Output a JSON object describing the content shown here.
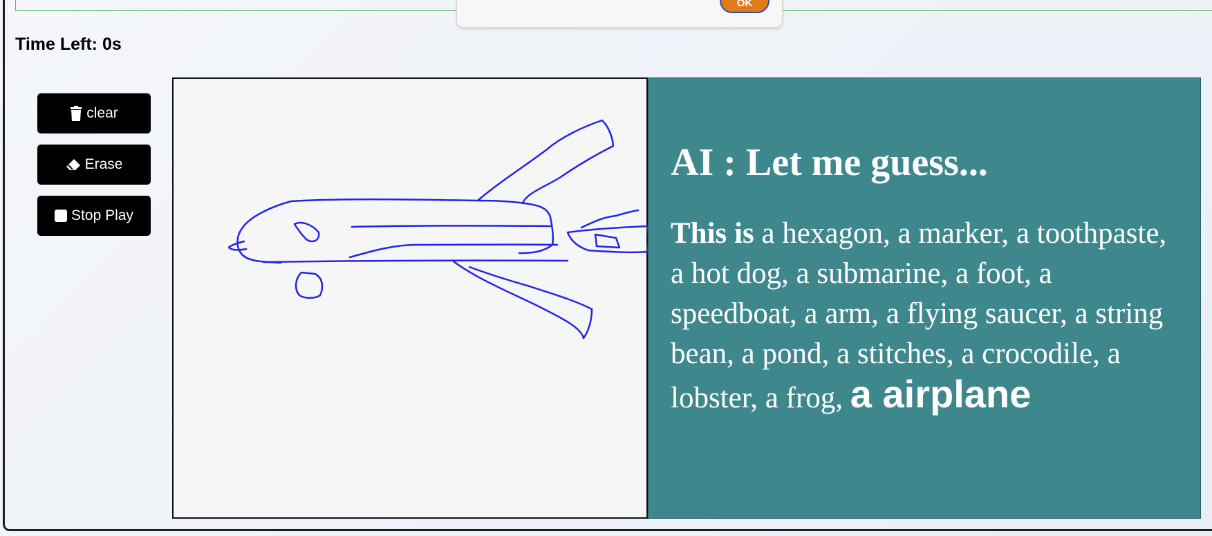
{
  "popup": {
    "ok_label": "OK"
  },
  "timer": {
    "text": "Time Left: 0s"
  },
  "toolbar": {
    "clear_label": "clear",
    "erase_label": "Erase",
    "stop_label": "Stop Play"
  },
  "icons": {
    "clear": "trash-icon",
    "erase": "eraser-icon",
    "stop": "stop-square-icon"
  },
  "canvas": {
    "stroke_color": "#2424e8",
    "background": "#f6f6f6"
  },
  "guess": {
    "heading": "AI : Let me guess...",
    "prefix": "This is",
    "candidates": "a hexagon, a marker, a toothpaste, a hot dog, a submarine, a foot, a speedboat, a arm, a flying saucer, a string bean, a pond, a stitches, a crocodile, a lobster, a frog,",
    "final": "a airplane"
  },
  "colors": {
    "panel_bg": "#3e888d",
    "button_bg": "#000000",
    "popup_button": "#e07a1a"
  }
}
